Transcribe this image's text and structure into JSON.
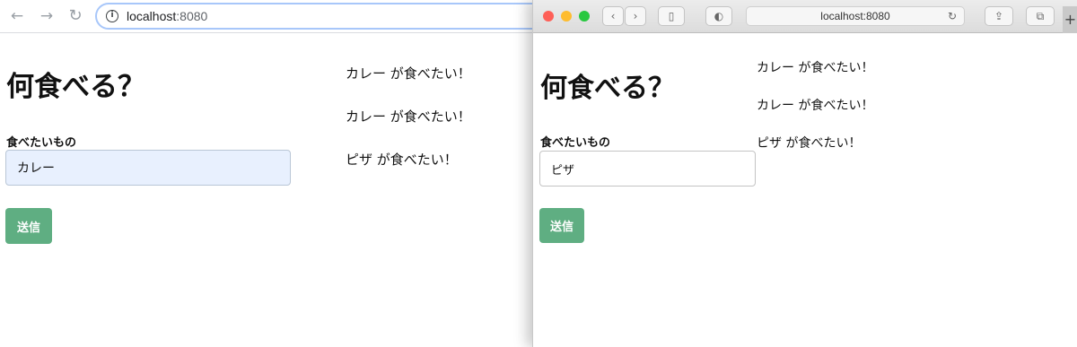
{
  "left_window": {
    "nav": {
      "back_icon": "arrow-left-icon",
      "forward_icon": "arrow-right-icon",
      "reload_icon": "reload-icon"
    },
    "address": {
      "host": "localhost",
      "port": ":8080"
    },
    "heading": "何食べる？",
    "field_label": "食べたいもの",
    "input_value": "カレー",
    "submit_label": "送信",
    "results": [
      "カレー が食べたい！",
      "カレー が食べたい！",
      "ピザ が食べたい！"
    ]
  },
  "right_window": {
    "address": "localhost:8080",
    "reload_icon": "reload-icon",
    "heading": "何食べる？",
    "field_label": "食べたいもの",
    "input_value": "ピザ",
    "submit_label": "送信",
    "results": [
      "カレー が食べたい！",
      "カレー が食べたい！",
      "ピザ が食べたい！"
    ]
  },
  "colors": {
    "submit_button": "#5fae82",
    "input_autofill_bg": "#e8f0fe",
    "traffic_close": "#fe5f57",
    "traffic_minimize": "#febc2e",
    "traffic_zoom": "#28c840",
    "omnibox_focus": "#a8c7fa"
  }
}
